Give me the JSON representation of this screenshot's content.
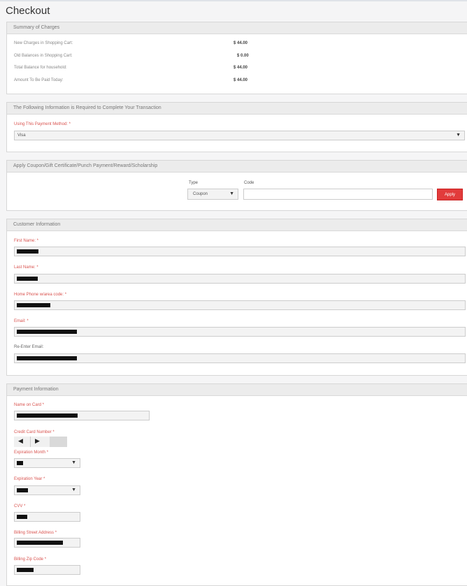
{
  "page": {
    "title": "Checkout"
  },
  "summary": {
    "header": "Summary of Charges",
    "rows": [
      {
        "label": "New Charges in Shopping Cart:",
        "value": "$ 44.00"
      },
      {
        "label": "Old Balances in Shopping Cart:",
        "value": "$ 0.00"
      },
      {
        "label": "Total Balance for household:",
        "value": "$ 44.00"
      },
      {
        "label": "Amount To Be Paid Today:",
        "value": "$ 44.00"
      }
    ]
  },
  "transaction": {
    "header": "The Following Information is Required to Complete Your Transaction",
    "payment_method_label": "Using This Payment Method: *",
    "payment_method_value": "Visa"
  },
  "coupon": {
    "header": "Apply Coupon/Gift Certificate/Punch Payment/Reward/Scholarship",
    "type_label": "Type",
    "type_value": "Coupon",
    "code_label": "Code",
    "apply_label": "Apply"
  },
  "customer": {
    "header": "Customer Information",
    "first_name_label": "First Name: *",
    "last_name_label": "Last Name: *",
    "phone_label": "Home Phone w/area code: *",
    "email_label": "Email: *",
    "reenter_email_label": "Re-Enter Email:"
  },
  "payment": {
    "header": "Payment Information",
    "name_on_card_label": "Name on Card *",
    "credit_card_label": "Credit Card Number *",
    "exp_month_label": "Expiration Month *",
    "exp_year_label": "Expiration Year *",
    "cvv_label": "CVV *",
    "street_label": "Billing Street Address *",
    "zip_label": "Billing Zip Code *"
  },
  "icons": {
    "dropdown": "triangle-down-icon",
    "cc_left": "arrow-left-icon",
    "cc_right": "arrow-right-icon"
  },
  "colors": {
    "required": "#d9534f",
    "apply_button": "#e23b3b"
  }
}
